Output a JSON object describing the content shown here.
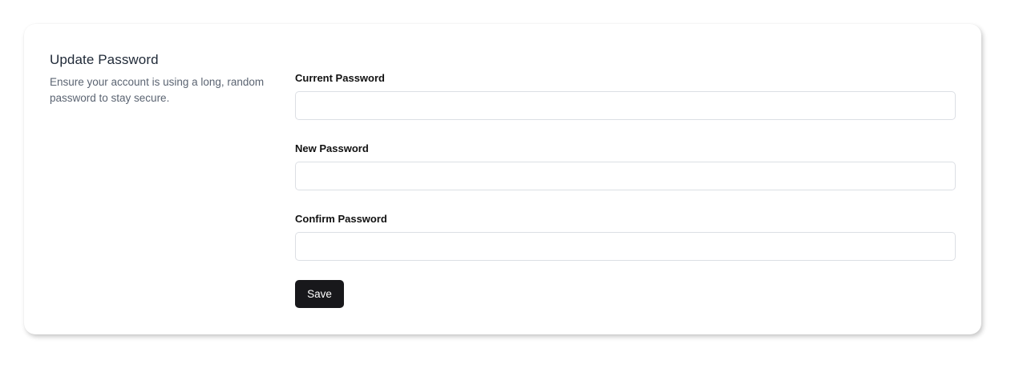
{
  "section": {
    "title": "Update Password",
    "description": "Ensure your account is using a long, random password to stay secure."
  },
  "fields": {
    "current_password": {
      "label": "Current Password",
      "value": "",
      "placeholder": ""
    },
    "new_password": {
      "label": "New Password",
      "value": "",
      "placeholder": ""
    },
    "confirm_password": {
      "label": "Confirm Password",
      "value": "",
      "placeholder": ""
    }
  },
  "actions": {
    "save_label": "Save"
  },
  "colors": {
    "button_background": "#18181b",
    "button_text": "#ffffff",
    "input_border": "#dcdfe4",
    "description_text": "#5b6472"
  }
}
